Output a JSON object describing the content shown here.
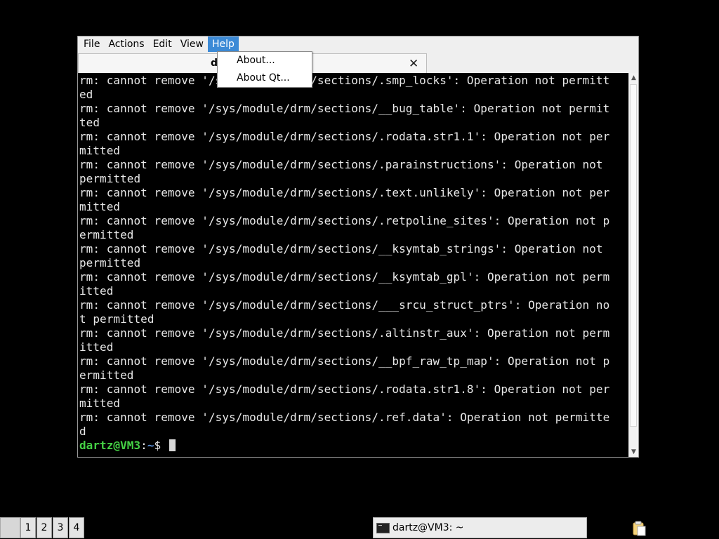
{
  "window": {
    "menu": [
      "File",
      "Actions",
      "Edit",
      "View",
      "Help"
    ],
    "active_menu": "Help",
    "tab": {
      "title": "d",
      "close_glyph": "✕"
    }
  },
  "help_menu": {
    "items": [
      "About...",
      "About Qt..."
    ]
  },
  "terminal": {
    "lines": [
      "rm: cannot remove '/sys/module/drm/sections/.smp_locks': Operation not permitt",
      "ed",
      "rm: cannot remove '/sys/module/drm/sections/__bug_table': Operation not permit",
      "ted",
      "rm: cannot remove '/sys/module/drm/sections/.rodata.str1.1': Operation not per",
      "mitted",
      "rm: cannot remove '/sys/module/drm/sections/.parainstructions': Operation not",
      "permitted",
      "rm: cannot remove '/sys/module/drm/sections/.text.unlikely': Operation not per",
      "mitted",
      "rm: cannot remove '/sys/module/drm/sections/.retpoline_sites': Operation not p",
      "ermitted",
      "rm: cannot remove '/sys/module/drm/sections/__ksymtab_strings': Operation not",
      "permitted",
      "rm: cannot remove '/sys/module/drm/sections/__ksymtab_gpl': Operation not perm",
      "itted",
      "rm: cannot remove '/sys/module/drm/sections/___srcu_struct_ptrs': Operation no",
      "t permitted",
      "rm: cannot remove '/sys/module/drm/sections/.altinstr_aux': Operation not perm",
      "itted",
      "rm: cannot remove '/sys/module/drm/sections/__bpf_raw_tp_map': Operation not p",
      "ermitted",
      "rm: cannot remove '/sys/module/drm/sections/.rodata.str1.8': Operation not per",
      "mitted",
      "rm: cannot remove '/sys/module/drm/sections/.ref.data': Operation not permitte",
      "d"
    ],
    "prompt": {
      "user_host": "dartz@VM3",
      "sep": ":",
      "path": "~",
      "symbol": "$ "
    }
  },
  "taskbar": {
    "workspaces": [
      "1",
      "2",
      "3",
      "4"
    ],
    "task_label": "dartz@VM3: ~"
  }
}
